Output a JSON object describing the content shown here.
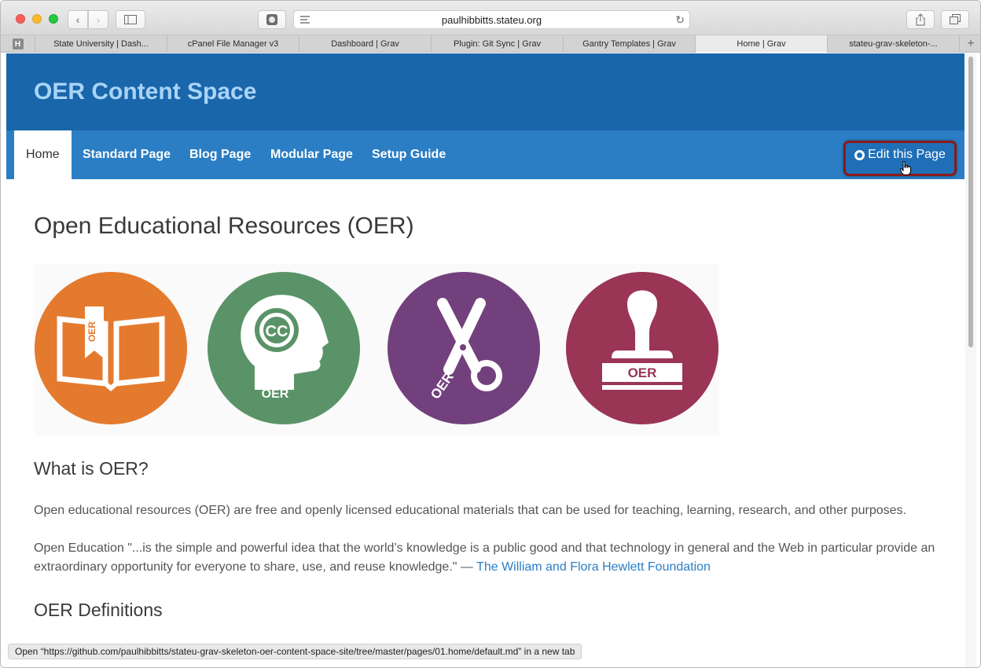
{
  "browser": {
    "url": "paulhibbitts.stateu.org",
    "tabs": [
      "State University | Dash...",
      "cPanel File Manager v3",
      "Dashboard | Grav",
      "Plugin: Git Sync | Grav",
      "Gantry Templates | Grav",
      "Home | Grav",
      "stateu-grav-skeleton-..."
    ],
    "active_tab": "Home | Grav",
    "favicon_letter": "H",
    "status_text": "Open “https://github.com/paulhibbitts/stateu-grav-skeleton-oer-content-space-site/tree/master/pages/01.home/default.md” in a new tab"
  },
  "site": {
    "title": "OER Content Space",
    "nav": [
      "Home",
      "Standard Page",
      "Blog Page",
      "Modular Page",
      "Setup Guide"
    ],
    "active_nav": "Home",
    "edit_button": "Edit this Page"
  },
  "content": {
    "heading": "Open Educational Resources (OER)",
    "oer_label": "OER",
    "cc_label": "CC",
    "icons": [
      "open-book",
      "cc-head",
      "scissors",
      "stamp"
    ],
    "icon_colors": [
      "#e47a2e",
      "#5a9367",
      "#72417d",
      "#9a3556"
    ],
    "what_heading": "What is OER?",
    "what_text": "Open educational resources (OER) are free and openly licensed educational materials that can be used for teaching, learning, research, and other purposes.",
    "quote_text": "Open Education \"...is the simple and powerful idea that the world’s knowledge is a public good and that technology in general and the Web in particular provide an extraordinary opportunity for everyone to share, use, and reuse knowledge.\" — ",
    "quote_link": "The William and Flora Hewlett Foundation",
    "definitions_heading": "OER Definitions"
  },
  "colors": {
    "header_bg": "#1a66ab",
    "nav_bg": "#2b7ec4",
    "title_color": "#a9d4f7",
    "link_color": "#2b7ec4"
  }
}
